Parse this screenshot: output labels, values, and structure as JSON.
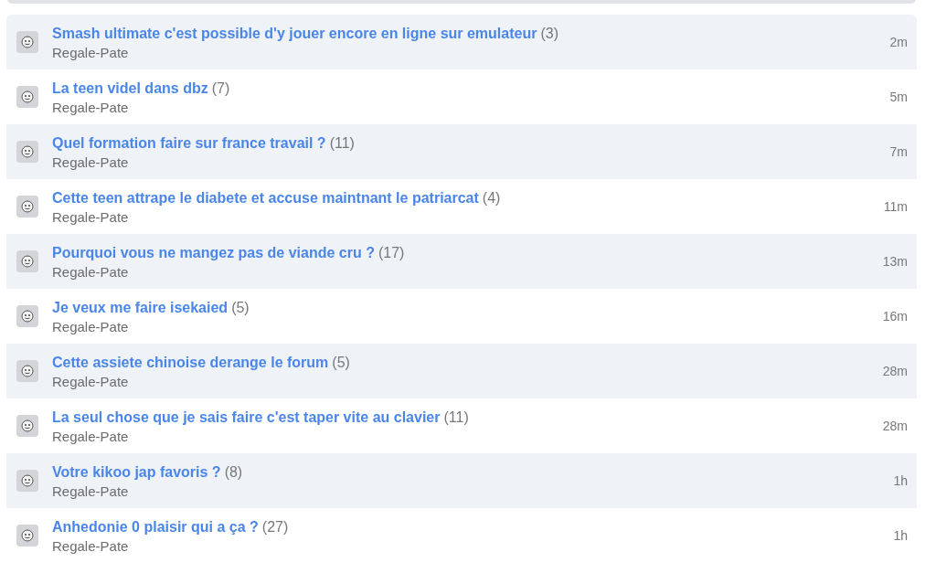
{
  "topics": [
    {
      "title": "Smash ultimate c'est possible d'y jouer encore en ligne sur emulateur",
      "count": "(3)",
      "author": "Regale-Pate",
      "time": "2m"
    },
    {
      "title": "La teen videl dans dbz",
      "count": "(7)",
      "author": "Regale-Pate",
      "time": "5m"
    },
    {
      "title": "Quel formation faire sur france travail ?",
      "count": "(11)",
      "author": "Regale-Pate",
      "time": "7m"
    },
    {
      "title": "Cette teen attrape le diabete et accuse maintnant le patriarcat",
      "count": "(4)",
      "author": "Regale-Pate",
      "time": "11m"
    },
    {
      "title": "Pourquoi vous ne mangez pas de viande cru ?",
      "count": "(17)",
      "author": "Regale-Pate",
      "time": "13m"
    },
    {
      "title": "Je veux me faire isekaied",
      "count": "(5)",
      "author": "Regale-Pate",
      "time": "16m"
    },
    {
      "title": "Cette assiete chinoise derange le forum",
      "count": "(5)",
      "author": "Regale-Pate",
      "time": "28m"
    },
    {
      "title": "La seul chose que je sais faire c'est taper vite au clavier",
      "count": "(11)",
      "author": "Regale-Pate",
      "time": "28m"
    },
    {
      "title": "Votre kikoo jap favoris ?",
      "count": "(8)",
      "author": "Regale-Pate",
      "time": "1h"
    },
    {
      "title": "Anhedonie 0 plaisir qui a ça ?",
      "count": "(27)",
      "author": "Regale-Pate",
      "time": "1h"
    }
  ]
}
